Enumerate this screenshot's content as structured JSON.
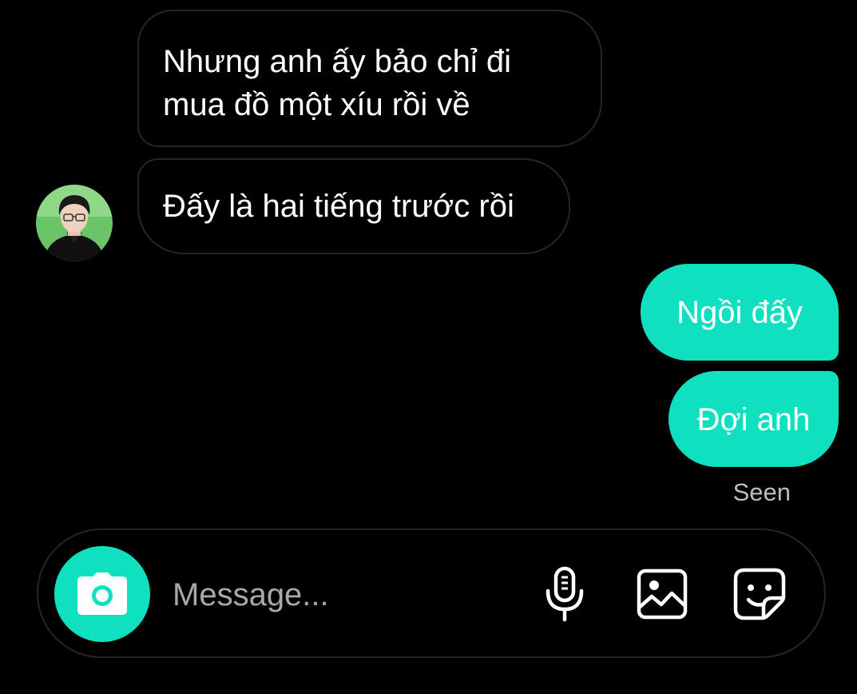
{
  "colors": {
    "background": "#000000",
    "outgoing_bubble": "#0fe0bf",
    "incoming_border": "#262626",
    "seen_text": "#bdbdbd",
    "placeholder": "#a8a8a8"
  },
  "messages": [
    {
      "direction": "incoming",
      "text": "Nhưng anh ấy bảo chỉ đi\nmua đồ một xíu rồi về"
    },
    {
      "direction": "incoming",
      "text": "Đấy là hai tiếng trước rồi",
      "sender_avatar": "avatar-icon"
    },
    {
      "direction": "outgoing",
      "text": "Ngồi đấy"
    },
    {
      "direction": "outgoing",
      "text": "Đợi anh"
    }
  ],
  "status": {
    "seen_label": "Seen"
  },
  "composer": {
    "placeholder": "Message...",
    "value": "",
    "icons": [
      "camera-icon",
      "microphone-icon",
      "gallery-icon",
      "sticker-icon"
    ]
  }
}
